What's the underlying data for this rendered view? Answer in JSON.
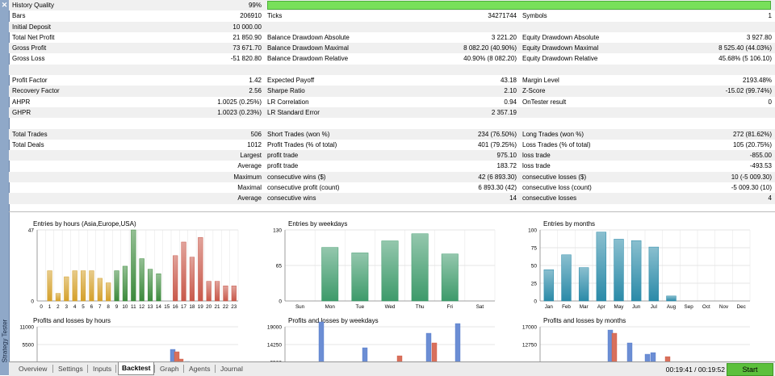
{
  "window": {
    "side_label": "Strategy Tester"
  },
  "report": {
    "history_quality": {
      "label": "History Quality",
      "value": "99%",
      "fraction": 0.99
    },
    "rows": [
      {
        "c1": "Bars",
        "v1": "206910",
        "c2": "Ticks",
        "v2": "34271744",
        "c3": "Symbols",
        "v3": "1"
      },
      {
        "c1": "Initial Deposit",
        "v1": "10 000.00",
        "c2": "",
        "v2": "",
        "c3": "",
        "v3": ""
      },
      {
        "c1": "Total Net Profit",
        "v1": "21 850.90",
        "c2": "Balance Drawdown Absolute",
        "v2": "3 221.20",
        "c3": "Equity Drawdown Absolute",
        "v3": "3 927.80"
      },
      {
        "c1": "Gross Profit",
        "v1": "73 671.70",
        "c2": "Balance Drawdown Maximal",
        "v2": "8 082.20 (40.90%)",
        "c3": "Equity Drawdown Maximal",
        "v3": "8 525.40 (44.03%)"
      },
      {
        "c1": "Gross Loss",
        "v1": "-51 820.80",
        "c2": "Balance Drawdown Relative",
        "v2": "40.90% (8 082.20)",
        "c3": "Equity Drawdown Relative",
        "v3": "45.68% (5 106.10)"
      },
      {
        "c1": "",
        "v1": "",
        "c2": "",
        "v2": "",
        "c3": "",
        "v3": ""
      },
      {
        "c1": "Profit Factor",
        "v1": "1.42",
        "c2": "Expected Payoff",
        "v2": "43.18",
        "c3": "Margin Level",
        "v3": "2193.48%"
      },
      {
        "c1": "Recovery Factor",
        "v1": "2.56",
        "c2": "Sharpe Ratio",
        "v2": "2.10",
        "c3": "Z-Score",
        "v3": "-15.02 (99.74%)"
      },
      {
        "c1": "AHPR",
        "v1": "1.0025 (0.25%)",
        "c2": "LR Correlation",
        "v2": "0.94",
        "c3": "OnTester result",
        "v3": "0"
      },
      {
        "c1": "GHPR",
        "v1": "1.0023 (0.23%)",
        "c2": "LR Standard Error",
        "v2": "2 357.19",
        "c3": "",
        "v3": ""
      },
      {
        "c1": "",
        "v1": "",
        "c2": "",
        "v2": "",
        "c3": "",
        "v3": ""
      },
      {
        "c1": "Total Trades",
        "v1": "506",
        "c2": "Short Trades (won %)",
        "v2": "234 (76.50%)",
        "c3": "Long Trades (won %)",
        "v3": "272 (81.62%)"
      },
      {
        "c1": "Total Deals",
        "v1": "1012",
        "c2": "Profit Trades (% of total)",
        "v2": "401 (79.25%)",
        "c3": "Loss Trades (% of total)",
        "v3": "105 (20.75%)"
      },
      {
        "r": "Largest",
        "c2": "profit trade",
        "v2": "975.10",
        "c3": "loss trade",
        "v3": "-855.00"
      },
      {
        "r": "Average",
        "c2": "profit trade",
        "v2": "183.72",
        "c3": "loss trade",
        "v3": "-493.53"
      },
      {
        "r": "Maximum",
        "c2": "consecutive wins ($)",
        "v2": "42 (6 893.30)",
        "c3": "consecutive losses ($)",
        "v3": "10 (-5 009.30)"
      },
      {
        "r": "Maximal",
        "c2": "consecutive profit (count)",
        "v2": "6 893.30 (42)",
        "c3": "consecutive loss (count)",
        "v3": "-5 009.30 (10)"
      },
      {
        "r": "Average",
        "c2": "consecutive wins",
        "v2": "14",
        "c3": "consecutive losses",
        "v3": "4"
      }
    ]
  },
  "chart_data": [
    {
      "type": "bar",
      "title": "Entries by hours (Asia,Europe,USA)",
      "ylim": [
        0,
        47
      ],
      "yticks": [
        "47",
        "0"
      ],
      "categories": [
        "0",
        "1",
        "2",
        "3",
        "4",
        "5",
        "6",
        "7",
        "8",
        "9",
        "10",
        "11",
        "12",
        "13",
        "14",
        "15",
        "16",
        "17",
        "18",
        "19",
        "20",
        "21",
        "22",
        "23"
      ],
      "values": [
        0,
        20,
        5,
        16,
        20,
        20,
        20,
        15,
        12,
        20,
        23,
        47,
        28,
        21,
        18,
        0,
        30,
        39,
        29,
        42,
        13,
        13,
        10,
        10
      ],
      "colors": [
        "#d4a02a",
        "#d4a02a",
        "#d4a02a",
        "#d4a02a",
        "#d4a02a",
        "#d4a02a",
        "#d4a02a",
        "#d4a02a",
        "#d4a02a",
        "#3c8a3c",
        "#3c8a3c",
        "#3c8a3c",
        "#3c8a3c",
        "#3c8a3c",
        "#3c8a3c",
        "#3c8a3c",
        "#c8584a",
        "#c8584a",
        "#c8584a",
        "#c8584a",
        "#c8584a",
        "#c8584a",
        "#c8584a",
        "#c8584a"
      ]
    },
    {
      "type": "bar",
      "title": "Entries by weekdays",
      "ylim": [
        0,
        130
      ],
      "yticks": [
        "130",
        "65",
        "0"
      ],
      "categories": [
        "Sun",
        "Mon",
        "Tue",
        "Wed",
        "Thu",
        "Fri",
        "Sat"
      ],
      "values": [
        0,
        98,
        88,
        110,
        123,
        86,
        0
      ],
      "color": "#3d9a6a"
    },
    {
      "type": "bar",
      "title": "Entries by months",
      "ylim": [
        0,
        100
      ],
      "yticks": [
        "100",
        "75",
        "50",
        "25",
        "0"
      ],
      "categories": [
        "Jan",
        "Feb",
        "Mar",
        "Apr",
        "May",
        "Jun",
        "Jul",
        "Aug",
        "Sep",
        "Oct",
        "Nov",
        "Dec"
      ],
      "values": [
        44,
        65,
        47,
        97,
        87,
        85,
        76,
        7,
        0,
        0,
        0,
        0
      ],
      "color": "#2a8aa8"
    },
    {
      "type": "bar",
      "title": "Profits and losses by hours",
      "yticks": [
        "11000",
        "5500"
      ],
      "partial": true
    },
    {
      "type": "bar",
      "title": "Profits and losses by weekdays",
      "yticks": [
        "19000",
        "14250",
        "9500"
      ],
      "partial": true
    },
    {
      "type": "bar",
      "title": "Profits and losses by months",
      "yticks": [
        "17000",
        "12750"
      ],
      "partial": true
    }
  ],
  "tabs": [
    "Overview",
    "Settings",
    "Inputs",
    "Backtest",
    "Graph",
    "Agents",
    "Journal"
  ],
  "active_tab": "Backtest",
  "status": {
    "timer": "00:19:41 / 00:19:52",
    "start_label": "Start"
  },
  "colors": {
    "quality_bar": "#78e05a",
    "start_button": "#5cc03c",
    "sidebar": "#8fa8c8"
  }
}
